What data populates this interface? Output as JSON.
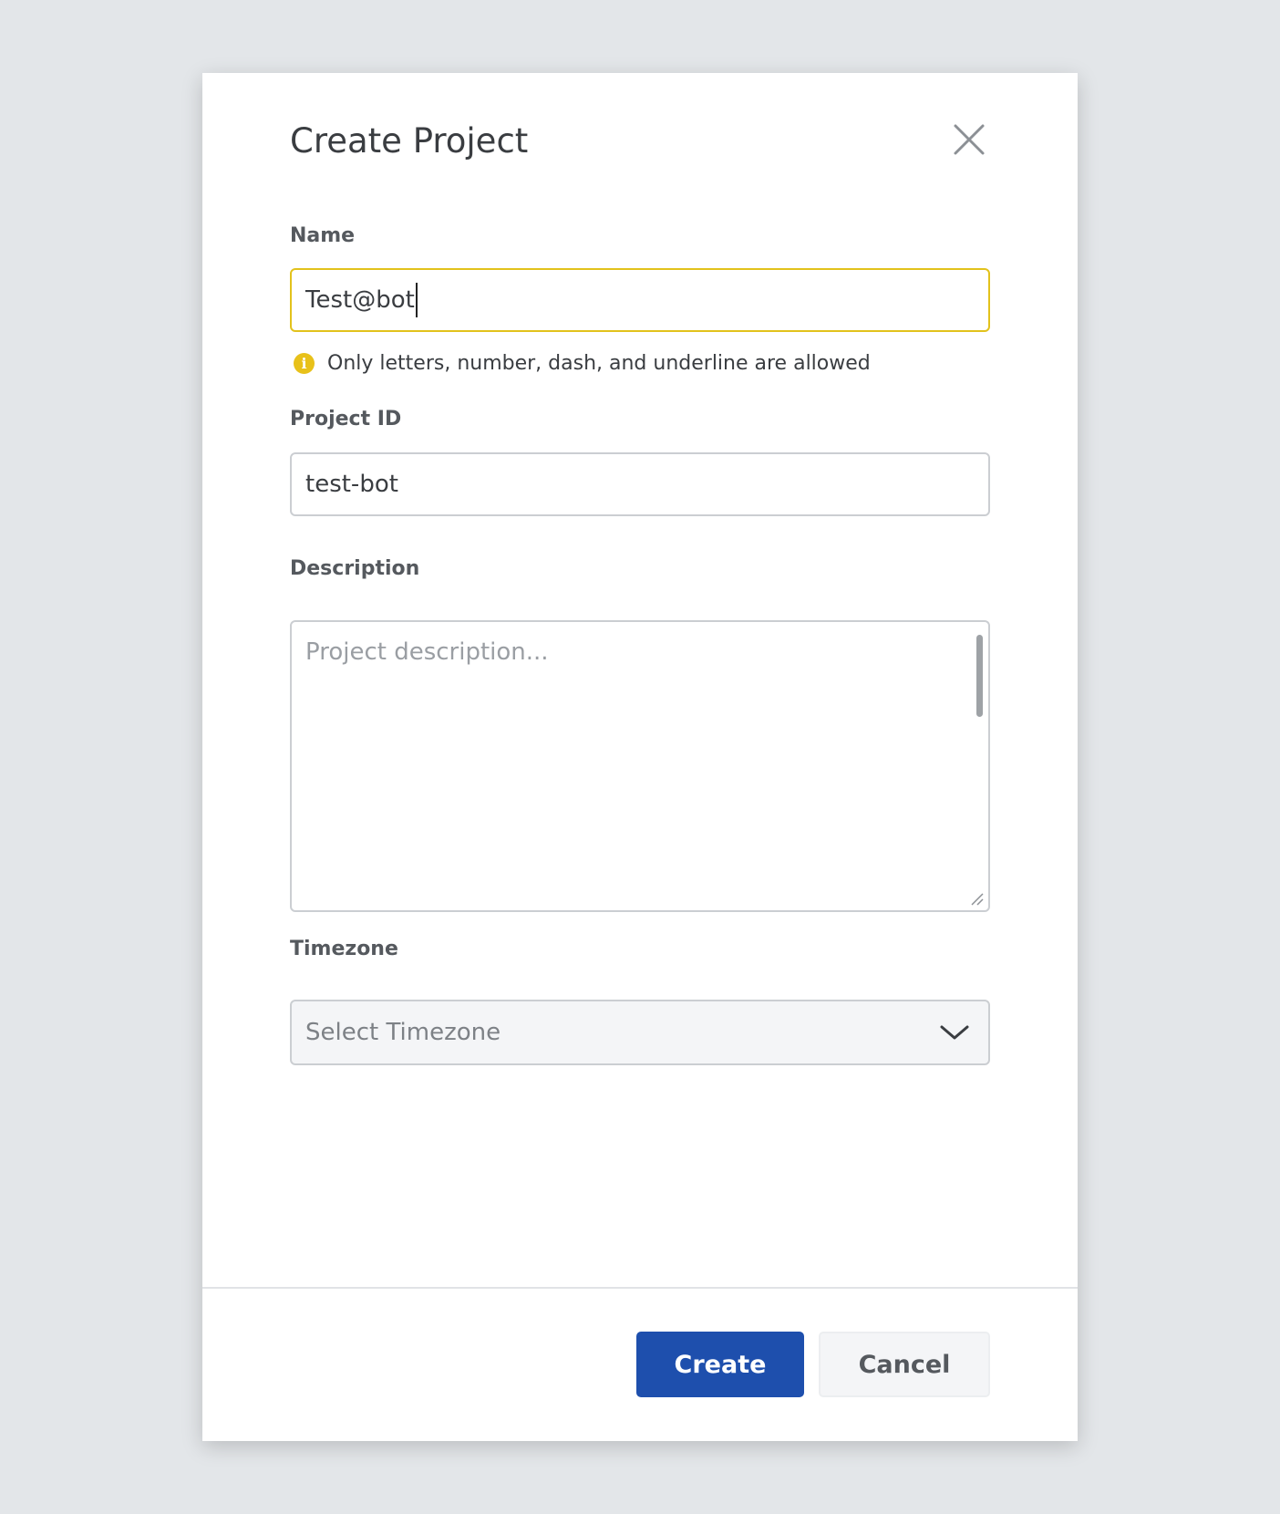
{
  "dialog": {
    "title": "Create Project"
  },
  "form": {
    "name": {
      "label": "Name",
      "value": "Test@bot",
      "hint": "Only letters, number, dash, and underline are allowed",
      "hint_icon": "info-icon",
      "focus_color": "#e2c21c"
    },
    "project_id": {
      "label": "Project ID",
      "value": "test-bot"
    },
    "description": {
      "label": "Description",
      "placeholder": "Project description..."
    },
    "timezone": {
      "label": "Timezone",
      "placeholder": "Select Timezone"
    }
  },
  "footer": {
    "create_label": "Create",
    "cancel_label": "Cancel",
    "primary_color": "#1e4fad"
  }
}
